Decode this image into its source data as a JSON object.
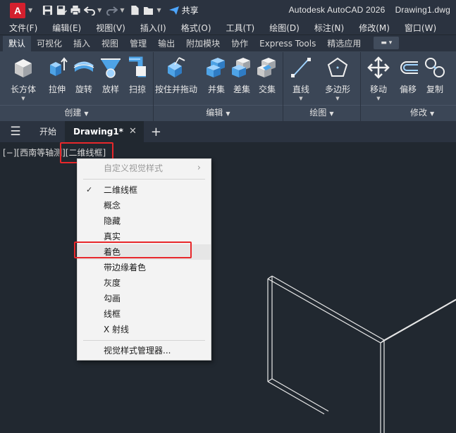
{
  "app": {
    "logo_letter": "A",
    "product": "Autodesk AutoCAD 2026",
    "filename": "Drawing1.dwg",
    "share_label": "共享"
  },
  "menu": [
    "文件(F)",
    "编辑(E)",
    "视图(V)",
    "插入(I)",
    "格式(O)",
    "工具(T)",
    "绘图(D)",
    "标注(N)",
    "修改(M)",
    "窗口(W)"
  ],
  "ribbon_tabs": [
    "默认",
    "可视化",
    "插入",
    "视图",
    "管理",
    "输出",
    "附加模块",
    "协作",
    "Express Tools",
    "精选应用"
  ],
  "ribbon_groups": {
    "create": {
      "title": "创建",
      "buttons": [
        "长方体",
        "拉伸",
        "旋转",
        "放样",
        "扫掠"
      ]
    },
    "edit": {
      "title": "编辑",
      "buttons": [
        "按住并拖动",
        "并集",
        "差集",
        "交集"
      ]
    },
    "draw": {
      "title": "绘图",
      "buttons": [
        "直线",
        "多边形"
      ]
    },
    "modify": {
      "title": "修改",
      "buttons": [
        "移动",
        "偏移",
        "复制"
      ]
    }
  },
  "doc_tabs": {
    "start": "开始",
    "active": "Drawing1*"
  },
  "viewport": {
    "controls": "[−][西南等轴测]",
    "visual_style": "[二维线框]"
  },
  "context_menu": {
    "header": "自定义视觉样式",
    "items": [
      "二维线框",
      "概念",
      "隐藏",
      "真实",
      "着色",
      "带边缘着色",
      "灰度",
      "勾画",
      "线框",
      "X 射线"
    ],
    "checked": "二维线框",
    "highlighted": "着色",
    "footer": "视觉样式管理器..."
  },
  "colors": {
    "accent_red": "#e8282b",
    "ribbon_bg": "#3b4656",
    "viewport_bg": "#212830",
    "share_icon": "#4da6ff",
    "logo_red": "#d4202e"
  }
}
